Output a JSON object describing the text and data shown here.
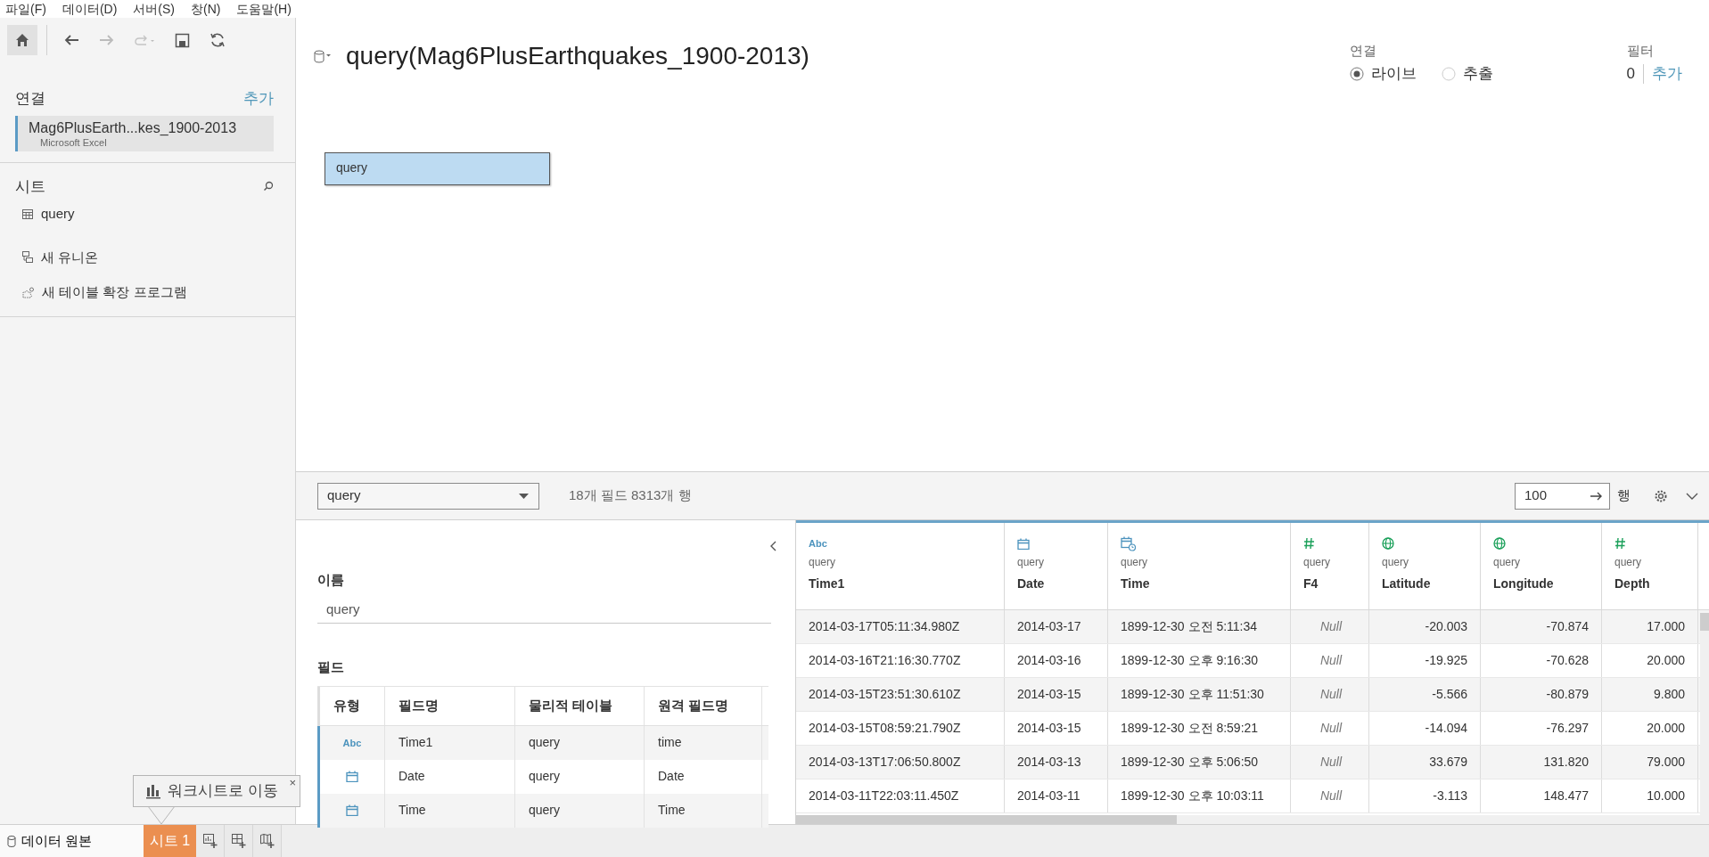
{
  "menu": [
    "파일(F)",
    "데이터(D)",
    "서버(S)",
    "창(N)",
    "도움말(H)"
  ],
  "sidebar": {
    "connections_title": "연결",
    "add_link": "추가",
    "connections": [
      {
        "name": "Mag6PlusEarth...kes_1900-2013",
        "type": "Microsoft Excel",
        "selected": true
      }
    ],
    "sheets_title": "시트",
    "sheets": [
      {
        "name": "query"
      }
    ],
    "actions": [
      {
        "kind": "union",
        "label": "새 유니온"
      },
      {
        "kind": "extension",
        "label": "새 테이블 확장 프로그램"
      }
    ]
  },
  "header": {
    "title": "query(Mag6PlusEarthquakes_1900-2013)",
    "connection_label": "연결",
    "connection_modes": [
      {
        "label": "라이브",
        "selected": true
      },
      {
        "label": "추출",
        "selected": false
      }
    ],
    "filter_label": "필터",
    "filter_count": "0",
    "filter_add": "추가"
  },
  "canvas": {
    "tables": [
      {
        "name": "query"
      }
    ]
  },
  "grid_toolbar": {
    "table_select": "query",
    "summary": "18개 필드 8313개 행",
    "row_limit": "100",
    "row_unit": "행"
  },
  "details": {
    "name_label": "이름",
    "name_value": "query",
    "fields_label": "필드",
    "field_columns": [
      "유형",
      "필드명",
      "물리적 테이블",
      "원격 필드명"
    ],
    "fields": [
      {
        "kind": "string",
        "type_label": "Abc",
        "name": "Time1",
        "table": "query",
        "remote": "time"
      },
      {
        "kind": "date",
        "name": "Date",
        "table": "query",
        "remote": "Date"
      },
      {
        "kind": "date",
        "name": "Time",
        "table": "query",
        "remote": "Time"
      }
    ]
  },
  "grid": {
    "columns": [
      {
        "kind": "string",
        "type_label": "Abc",
        "source": "query",
        "name": "Time1"
      },
      {
        "kind": "date",
        "source": "query",
        "name": "Date"
      },
      {
        "kind": "datetime",
        "source": "query",
        "name": "Time"
      },
      {
        "kind": "number",
        "source": "query",
        "name": "F4"
      },
      {
        "kind": "geo",
        "source": "query",
        "name": "Latitude"
      },
      {
        "kind": "geo",
        "source": "query",
        "name": "Longitude"
      },
      {
        "kind": "number",
        "source": "query",
        "name": "Depth"
      }
    ],
    "rows": [
      [
        "2014-03-17T05:11:34.980Z",
        "2014-03-17",
        "1899-12-30 오전 5:11:34",
        {
          "text": "Null",
          "null": true
        },
        "-20.003",
        "-70.874",
        "17.000"
      ],
      [
        "2014-03-16T21:16:30.770Z",
        "2014-03-16",
        "1899-12-30 오후 9:16:30",
        {
          "text": "Null",
          "null": true
        },
        "-19.925",
        "-70.628",
        "20.000"
      ],
      [
        "2014-03-15T23:51:30.610Z",
        "2014-03-15",
        "1899-12-30 오후 11:51:30",
        {
          "text": "Null",
          "null": true
        },
        "-5.566",
        "-80.879",
        "9.800"
      ],
      [
        "2014-03-15T08:59:21.790Z",
        "2014-03-15",
        "1899-12-30 오전 8:59:21",
        {
          "text": "Null",
          "null": true
        },
        "-14.094",
        "-76.297",
        "20.000"
      ],
      [
        "2014-03-13T17:06:50.800Z",
        "2014-03-13",
        "1899-12-30 오후 5:06:50",
        {
          "text": "Null",
          "null": true
        },
        "33.679",
        "131.820",
        "79.000"
      ],
      [
        "2014-03-11T22:03:11.450Z",
        "2014-03-11",
        "1899-12-30 오후 10:03:11",
        {
          "text": "Null",
          "null": true
        },
        "-3.113",
        "148.477",
        "10.000"
      ]
    ]
  },
  "tooltip": {
    "text": "워크시트로 이동",
    "close": "×"
  },
  "bottom_tabs": {
    "data_source": "데이터 원본",
    "sheets": [
      {
        "label": "시트 1",
        "selected": true
      }
    ]
  }
}
